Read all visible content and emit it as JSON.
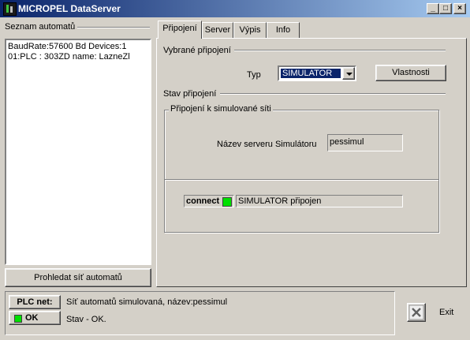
{
  "window": {
    "title": "MICROPEL DataServer"
  },
  "controls": {
    "minimize": "_",
    "maximize": "□",
    "close": "×"
  },
  "left_panel": {
    "title": "Seznam automatů",
    "list": [
      "BaudRate:57600 Bd Devices:1",
      "01:PLC : 303ZD name: LazneZl"
    ],
    "search_button": "Prohledat síť automatů"
  },
  "tabs": [
    "Připojení",
    "Server",
    "Výpis",
    "Info"
  ],
  "connection": {
    "selected_title": "Vybrané připojení",
    "type_label": "Typ",
    "type_value": "SIMULATOR",
    "properties_button": "Vlastnosti",
    "status_title": "Stav připojení",
    "sim_group_title": "Připojení k simulované síti",
    "server_name_label": "Název serveru Simulátoru",
    "server_name_value": "pessimul",
    "connect_label": "connect",
    "connect_status": "SIMULATOR připojen"
  },
  "status_bar": {
    "plc_label": "PLC net:",
    "ok_label": "OK",
    "message1": "Síť automatů simulovaná, název:pessimul",
    "message2": "Stav - OK."
  },
  "exit": {
    "label": "Exit"
  },
  "colors": {
    "title_start": "#0a246a",
    "title_end": "#a6caf0",
    "indicator": "#00e000",
    "select_bg": "#0a246a"
  }
}
